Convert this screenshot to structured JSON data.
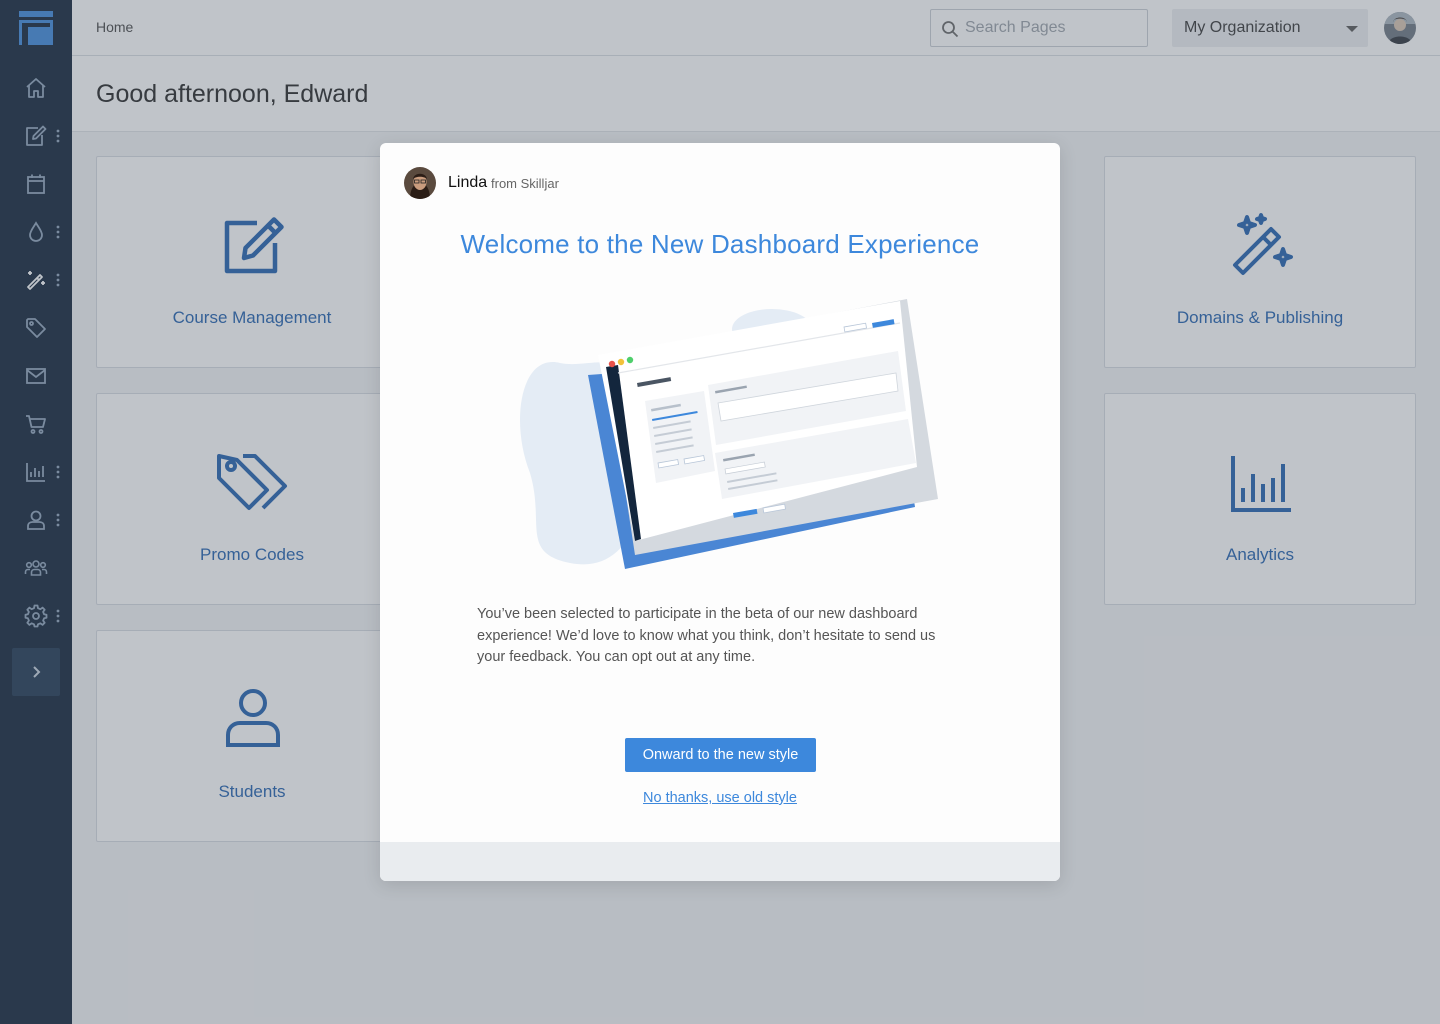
{
  "topbar": {
    "breadcrumb": "Home",
    "search_placeholder": "Search Pages",
    "org_selector": "My Organization"
  },
  "header": {
    "greeting": "Good afternoon, Edward"
  },
  "sidebar": {
    "items": [
      {
        "icon": "home-icon"
      },
      {
        "icon": "edit-icon",
        "has_menu": true
      },
      {
        "icon": "calendar-icon"
      },
      {
        "icon": "drop-icon",
        "has_menu": true
      },
      {
        "icon": "magic-wand-icon",
        "has_menu": true
      },
      {
        "icon": "tag-icon"
      },
      {
        "icon": "mail-icon"
      },
      {
        "icon": "cart-icon"
      },
      {
        "icon": "chart-icon",
        "has_menu": true
      },
      {
        "icon": "user-icon",
        "has_menu": true
      },
      {
        "icon": "users-icon"
      },
      {
        "icon": "gear-icon",
        "has_menu": true
      }
    ],
    "expand_icon": "chevron-right-icon"
  },
  "cards": [
    {
      "label": "Course Management",
      "icon": "edit-icon"
    },
    {
      "label": "Domains & Publishing",
      "icon": "magic-wand-icon"
    },
    {
      "label": "Promo Codes",
      "icon": "tags-icon"
    },
    {
      "label": "Analytics",
      "icon": "bar-chart-icon"
    },
    {
      "label": "Students",
      "icon": "user-icon"
    }
  ],
  "modal": {
    "sender_name": "Linda",
    "sender_from": "from Skilljar",
    "title": "Welcome to the New Dashboard Experience",
    "body": "You’ve been selected to participate in the beta of our new dashboard experience! We’d love to know what you think, don’t hesitate to send us your feedback. You can opt out at any time.",
    "primary_button": "Onward to the new style",
    "secondary_link": "No thanks, use old style"
  },
  "colors": {
    "sidebar": "#0d2036",
    "accent": "#3d88dc",
    "card_text": "#1f5fae"
  }
}
